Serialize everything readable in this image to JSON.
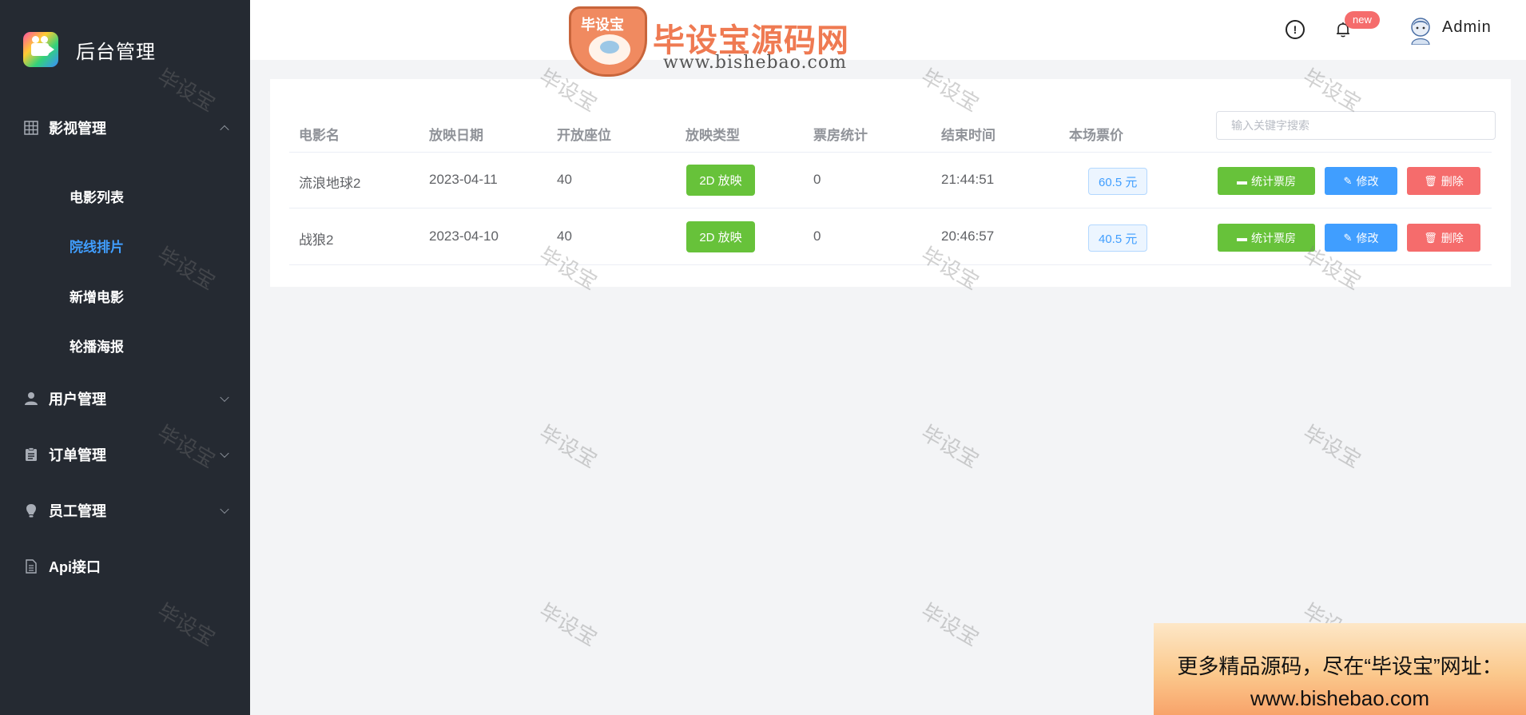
{
  "brand": {
    "title": "后台管理"
  },
  "sidebar": {
    "groups": [
      {
        "label": "影视管理",
        "icon": "grid-icon",
        "expanded": true
      },
      {
        "label": "用户管理",
        "icon": "user-icon",
        "expanded": false
      },
      {
        "label": "订单管理",
        "icon": "clipboard-icon",
        "expanded": false
      },
      {
        "label": "员工管理",
        "icon": "bulb-icon",
        "expanded": false
      },
      {
        "label": "Api接口",
        "icon": "document-icon"
      }
    ],
    "subitems": [
      {
        "label": "电影列表",
        "active": false
      },
      {
        "label": "院线排片",
        "active": true
      },
      {
        "label": "新增电影",
        "active": false
      },
      {
        "label": "轮播海报",
        "active": false
      }
    ]
  },
  "header": {
    "site_logo": {
      "badge": "毕设宝",
      "name": "毕设宝源码网",
      "url": "www.bishebao.com"
    },
    "notification_badge": "new",
    "user": "Admin"
  },
  "table": {
    "columns": [
      "电影名",
      "放映日期",
      "开放座位",
      "放映类型",
      "票房统计",
      "结束时间",
      "本场票价"
    ],
    "search_placeholder": "输入关键字搜索",
    "rows": [
      {
        "name": "流浪地球2",
        "date": "2023-04-11",
        "seats": "40",
        "type": "2D 放映",
        "box_office": "0",
        "end_time": "21:44:51",
        "price": "60.5 元"
      },
      {
        "name": "战狼2",
        "date": "2023-04-10",
        "seats": "40",
        "type": "2D 放映",
        "box_office": "0",
        "end_time": "20:46:57",
        "price": "40.5 元"
      }
    ],
    "actions": {
      "stat": "统计票房",
      "edit": "修改",
      "delete": "删除"
    }
  },
  "watermark": "毕设宝",
  "promo": {
    "line1": "更多精品源码，尽在“毕设宝”网址：",
    "line2": "www.bishebao.com"
  },
  "colors": {
    "sidebar_bg": "#252a32",
    "active": "#409eff",
    "success": "#67c23a",
    "danger": "#f56c6c",
    "primary": "#409eff"
  }
}
